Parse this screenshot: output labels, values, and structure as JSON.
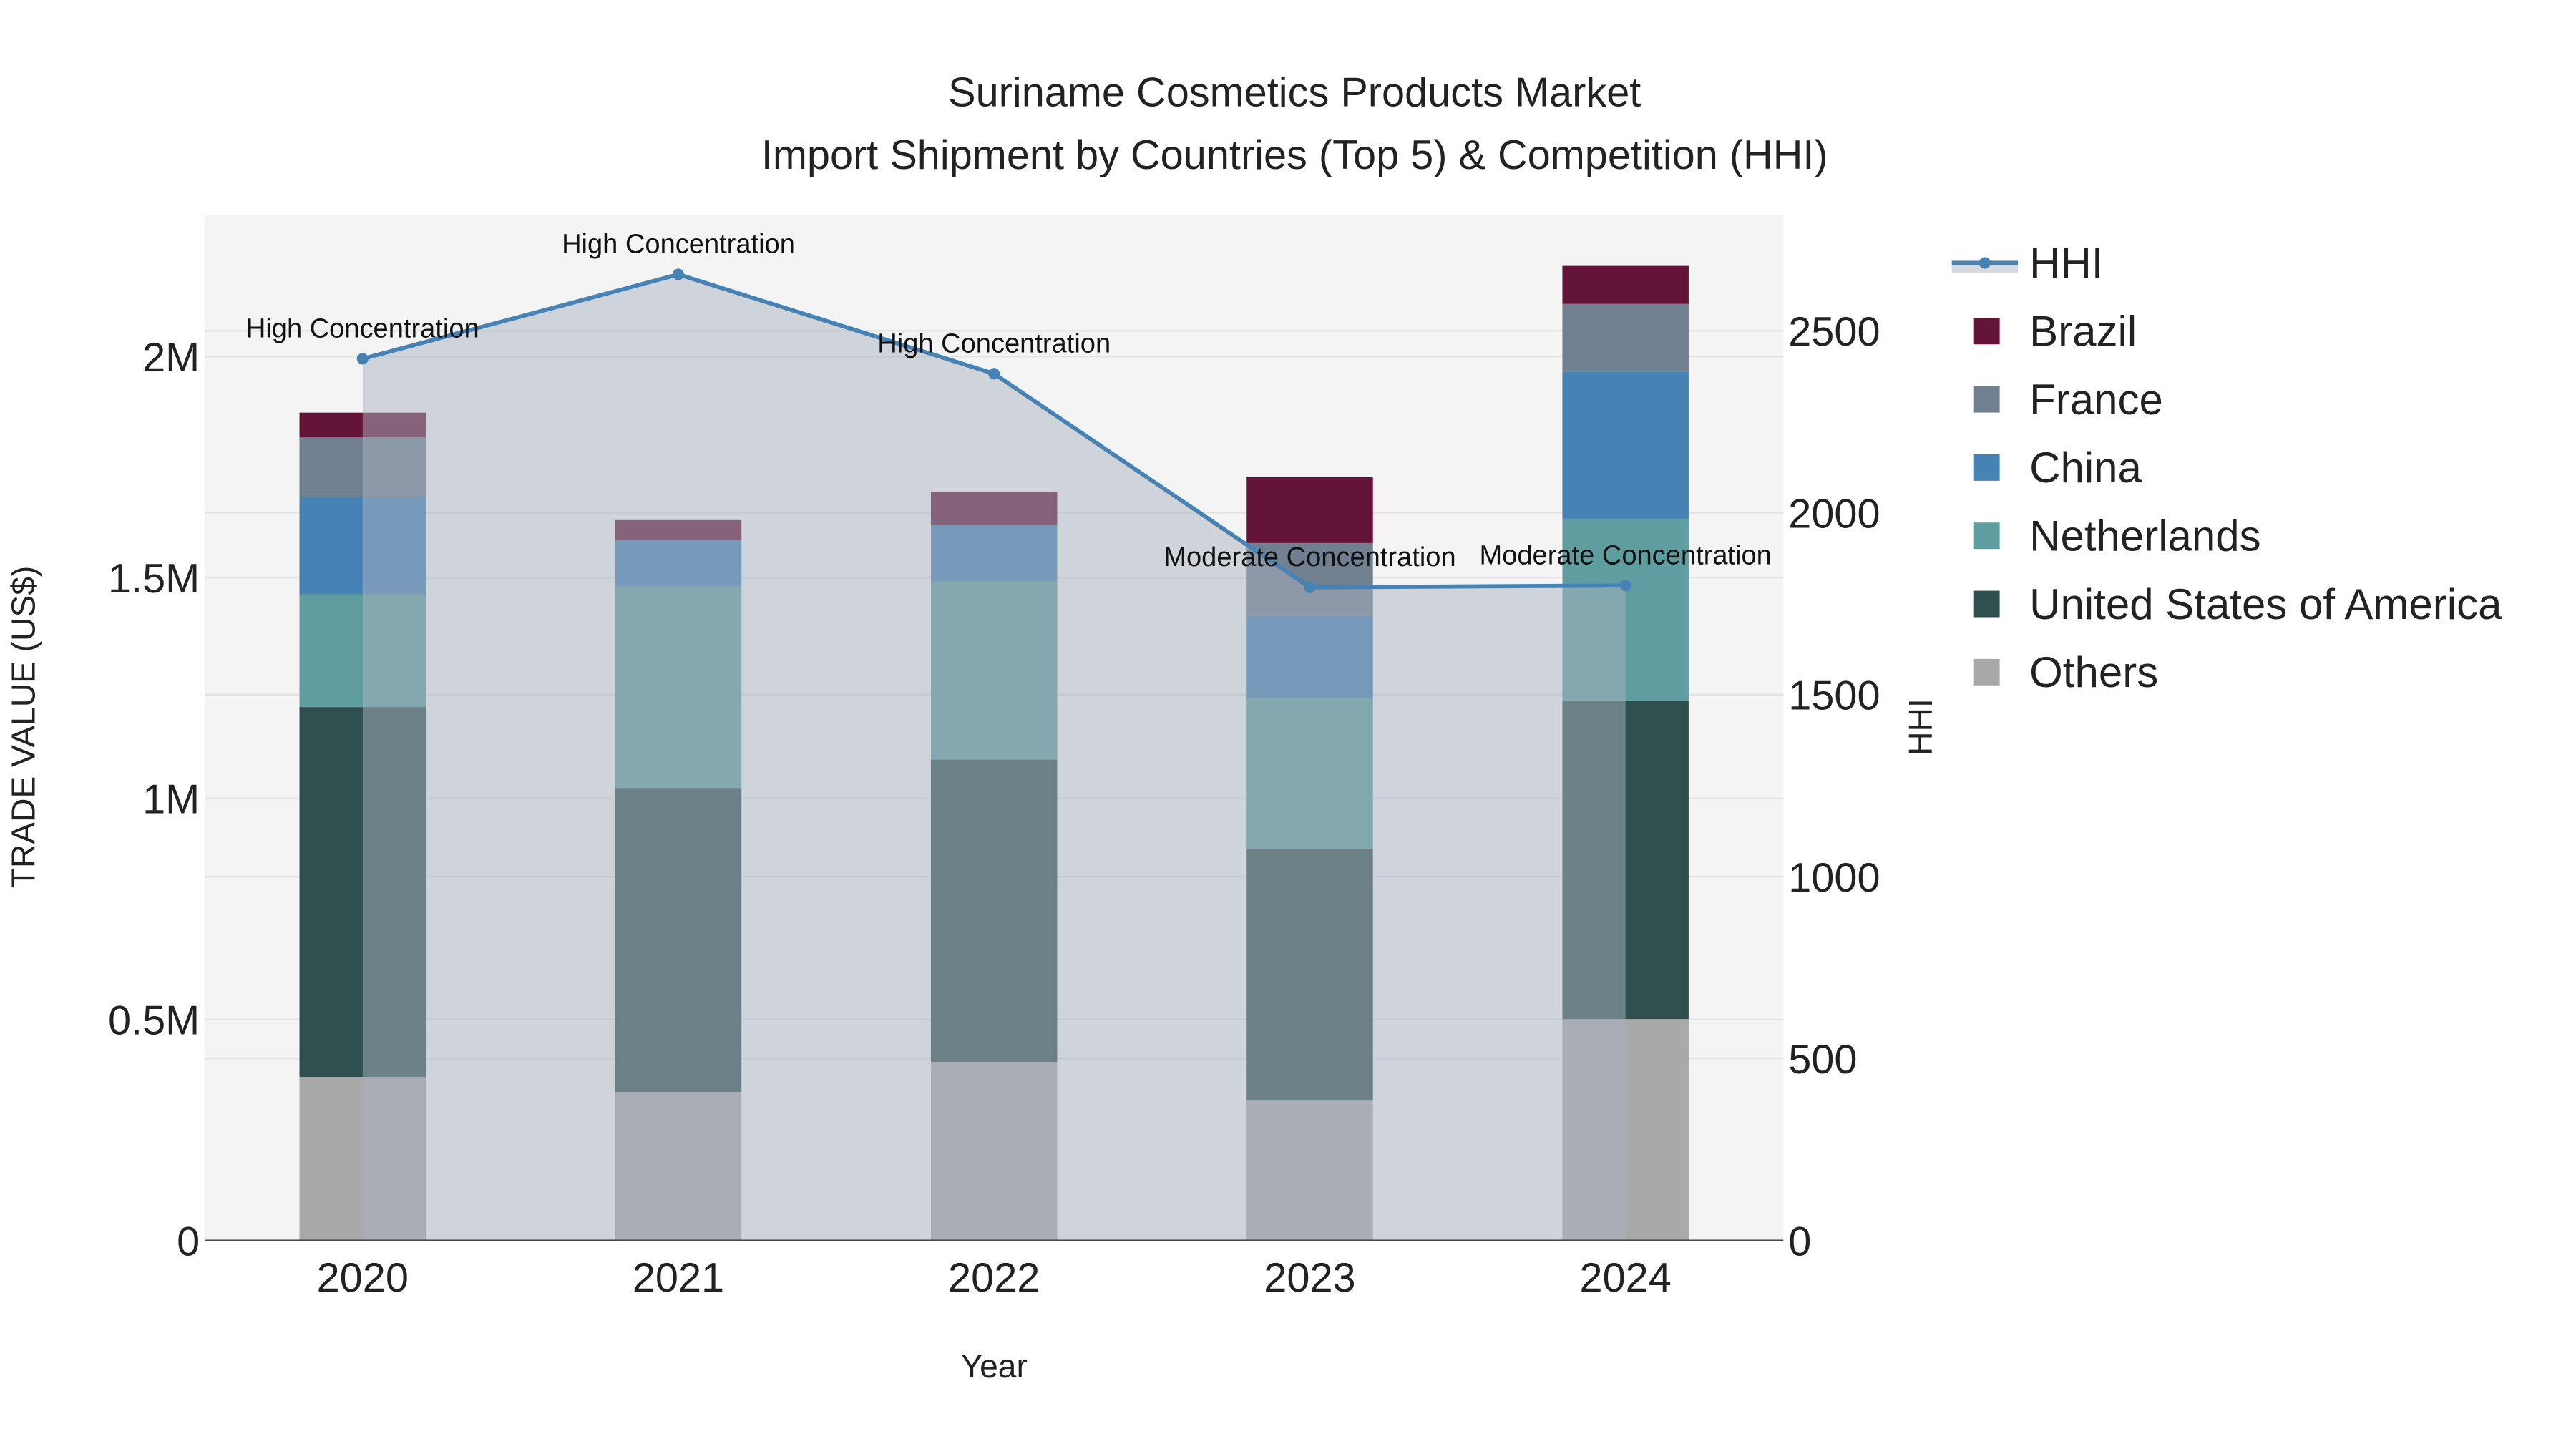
{
  "chart_data": {
    "type": "bar",
    "title": "Suriname Cosmetics Products Market",
    "subtitle": "Import Shipment by Countries (Top 5) & Competition (HHI)",
    "xlabel": "Year",
    "ylabel": "TRADE VALUE (US$)",
    "y2label": "HHI",
    "categories": [
      "2020",
      "2021",
      "2022",
      "2023",
      "2024"
    ],
    "ylim": [
      0,
      2320000
    ],
    "y2lim": [
      0,
      2818
    ],
    "yticks": [
      {
        "v": 0,
        "label": "0"
      },
      {
        "v": 500000,
        "label": "0.5M"
      },
      {
        "v": 1000000,
        "label": "1M"
      },
      {
        "v": 1500000,
        "label": "1.5M"
      },
      {
        "v": 2000000,
        "label": "2M"
      }
    ],
    "y2ticks": [
      0,
      500,
      1000,
      1500,
      2000,
      2500
    ],
    "grid": true,
    "legend_position": "right",
    "series": [
      {
        "name": "Others",
        "color": "#A9A9A9",
        "values": [
          370000,
          336000,
          404000,
          318000,
          501000
        ]
      },
      {
        "name": "United States of America",
        "color": "#2F4F4F",
        "values": [
          837000,
          688000,
          684000,
          568000,
          721000
        ]
      },
      {
        "name": "Netherlands",
        "color": "#5F9EA0",
        "values": [
          255000,
          456000,
          404000,
          340000,
          411000
        ]
      },
      {
        "name": "China",
        "color": "#4682B4",
        "values": [
          220000,
          105000,
          127000,
          187000,
          333000
        ]
      },
      {
        "name": "France",
        "color": "#708090",
        "values": [
          135000,
          0,
          0,
          165000,
          153000
        ]
      },
      {
        "name": "Brazil",
        "color": "#641436",
        "values": [
          56000,
          45000,
          75000,
          149000,
          86000
        ]
      }
    ],
    "hhi": {
      "name": "HHI",
      "color": "#4682B4",
      "values": [
        2423,
        2655,
        2382,
        1795,
        1800
      ],
      "annotations": [
        "High Concentration",
        "High Concentration",
        "High Concentration",
        "Moderate Concentration",
        "Moderate Concentration"
      ]
    },
    "legend_order": [
      "HHI",
      "Brazil",
      "France",
      "China",
      "Netherlands",
      "United States of America",
      "Others"
    ]
  }
}
